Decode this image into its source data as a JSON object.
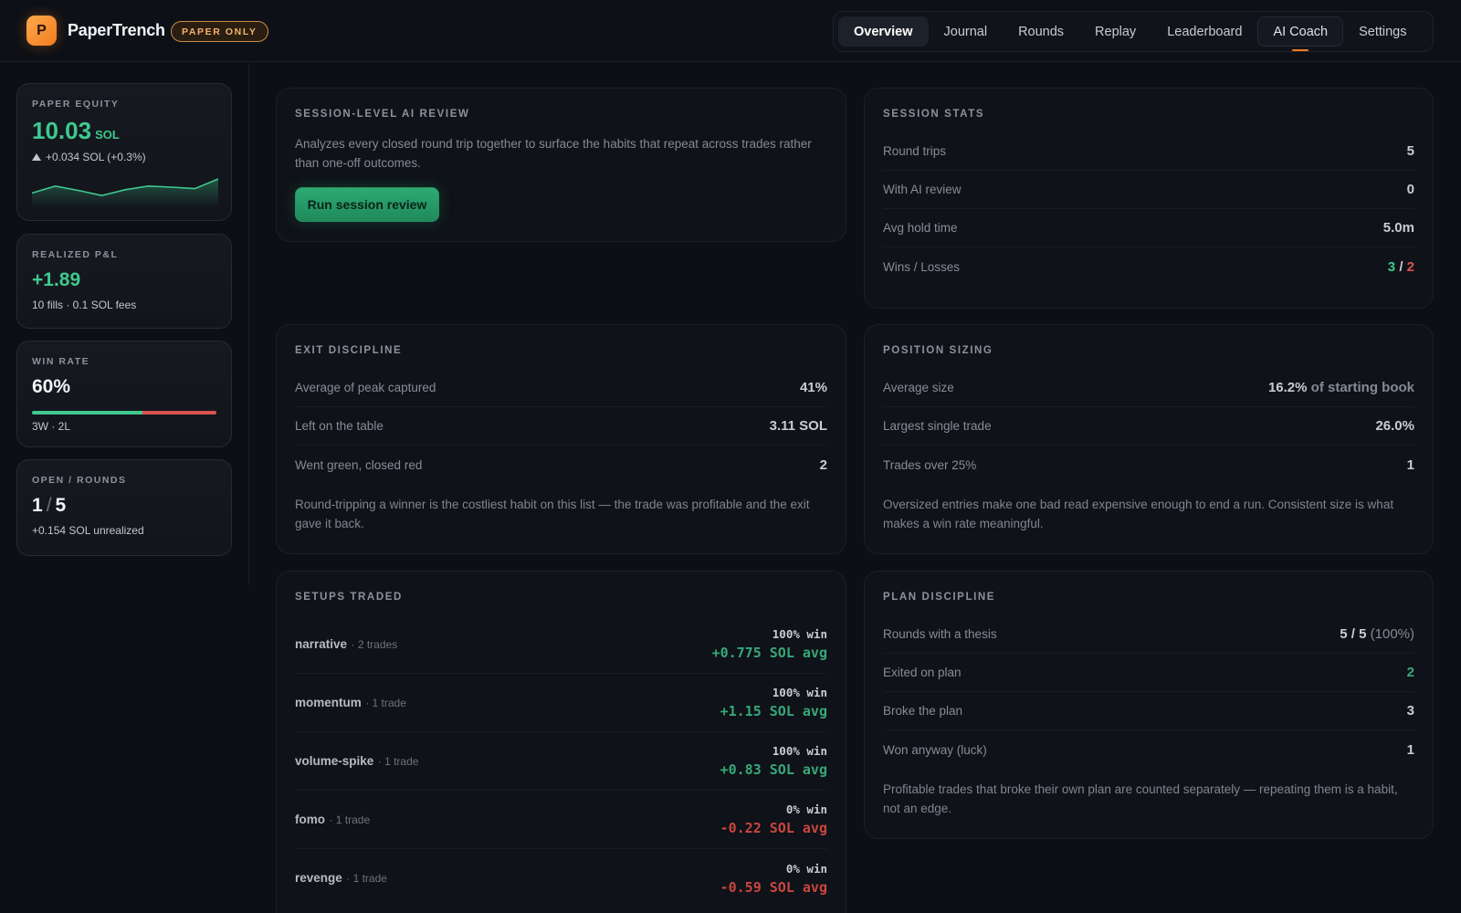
{
  "header": {
    "logo_letter": "P",
    "brand": "PaperTrench",
    "badge": "PAPER ONLY",
    "nav": [
      {
        "label": "Overview"
      },
      {
        "label": "Journal"
      },
      {
        "label": "Rounds"
      },
      {
        "label": "Replay"
      },
      {
        "label": "Leaderboard"
      },
      {
        "label": "AI Coach"
      },
      {
        "label": "Settings"
      }
    ]
  },
  "sidebar": {
    "equity": {
      "label": "PAPER EQUITY",
      "value": "10.03",
      "unit": "SOL",
      "change": "+0.034 SOL (+0.3%)",
      "sparkline": [
        0.45,
        0.72,
        0.55,
        0.35,
        0.58,
        0.72,
        0.68,
        0.62,
        1.0
      ]
    },
    "pnl": {
      "label": "REALIZED P&L",
      "value": "+1.89",
      "sub": "10 fills · 0.1 SOL fees"
    },
    "winrate": {
      "label": "WIN RATE",
      "value": "60%",
      "win_fraction": 0.6,
      "sub": "3W · 2L"
    },
    "rounds": {
      "label": "OPEN / ROUNDS",
      "open": "1",
      "sep": "/",
      "total": "5",
      "sub": "+0.154 SOL unrealized"
    }
  },
  "review": {
    "title": "SESSION-LEVEL AI REVIEW",
    "desc": "Analyzes every closed round trip together to surface the habits that repeat across trades rather than one-off outcomes.",
    "button": "Run session review"
  },
  "stats": {
    "title": "SESSION STATS",
    "rows": [
      {
        "k": "Round trips",
        "v": "5"
      },
      {
        "k": "With AI review",
        "v": "0"
      },
      {
        "k": "Avg hold time",
        "v": "5.0m"
      }
    ],
    "wl_label": "Wins / Losses",
    "wins": "3",
    "wl_sep": "/",
    "losses": "2"
  },
  "exit": {
    "title": "EXIT DISCIPLINE",
    "rows": [
      {
        "k": "Average of peak captured",
        "v": "41%"
      },
      {
        "k": "Left on the table",
        "v": "3.11 SOL"
      },
      {
        "k": "Went green, closed red",
        "v": "2"
      }
    ],
    "note": "Round-tripping a winner is the costliest habit on this list — the trade was profitable and the exit gave it back."
  },
  "sizing": {
    "title": "POSITION SIZING",
    "avg_label": "Average size",
    "avg_value": "16.2%",
    "avg_suffix": "of starting book",
    "rows": [
      {
        "k": "Largest single trade",
        "v": "26.0%"
      },
      {
        "k": "Trades over 25%",
        "v": "1"
      }
    ],
    "note": "Oversized entries make one bad read expensive enough to end a run. Consistent size is what makes a win rate meaningful."
  },
  "setups": {
    "title": "SETUPS TRADED",
    "items": [
      {
        "name": "narrative",
        "count": "· 2 trades",
        "win": "100% win",
        "avg": "+0.775 SOL avg"
      },
      {
        "name": "momentum",
        "count": "· 1 trade",
        "win": "100% win",
        "avg": "+1.15 SOL avg"
      },
      {
        "name": "volume-spike",
        "count": "· 1 trade",
        "win": "100% win",
        "avg": "+0.83 SOL avg"
      },
      {
        "name": "fomo",
        "count": "· 1 trade",
        "win": "0% win",
        "avg": "-0.22 SOL avg"
      },
      {
        "name": "revenge",
        "count": "· 1 trade",
        "win": "0% win",
        "avg": "-0.59 SOL avg"
      }
    ]
  },
  "plan": {
    "title": "PLAN DISCIPLINE",
    "thesis_label": "Rounds with a thesis",
    "thesis_value": "5 / 5",
    "thesis_pct": "(100%)",
    "rows": [
      {
        "k": "Exited on plan",
        "v": "2"
      },
      {
        "k": "Broke the plan",
        "v": "3"
      },
      {
        "k": "Won anyway (luck)",
        "v": "1"
      }
    ],
    "note": "Profitable trades that broke their own plan are counted separately — repeating them is a habit, not an edge."
  },
  "colors": {
    "accent": "#f07d1f",
    "positive": "#3ec98f",
    "negative": "#d9534f",
    "warning": "#e89a3c"
  }
}
